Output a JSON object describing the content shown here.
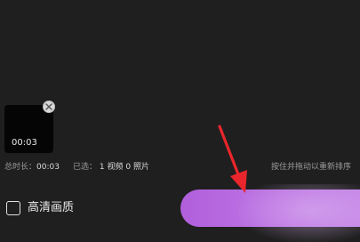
{
  "media": {
    "thumbnail_duration": "00:03",
    "remove_icon": "close-icon"
  },
  "summary": {
    "total_label": "总时长：",
    "total_value": "00:03",
    "selected_label": "已选：",
    "video_count": "1",
    "video_unit": "视频",
    "photo_count": "0",
    "photo_unit": "照片",
    "reorder_hint": "按住并拖动以重新排序"
  },
  "options": {
    "hd_label": "高清画质"
  },
  "colors": {
    "background": "#1f1f1f",
    "accent": "#b96ce0",
    "annotation_arrow": "#e8262c"
  }
}
